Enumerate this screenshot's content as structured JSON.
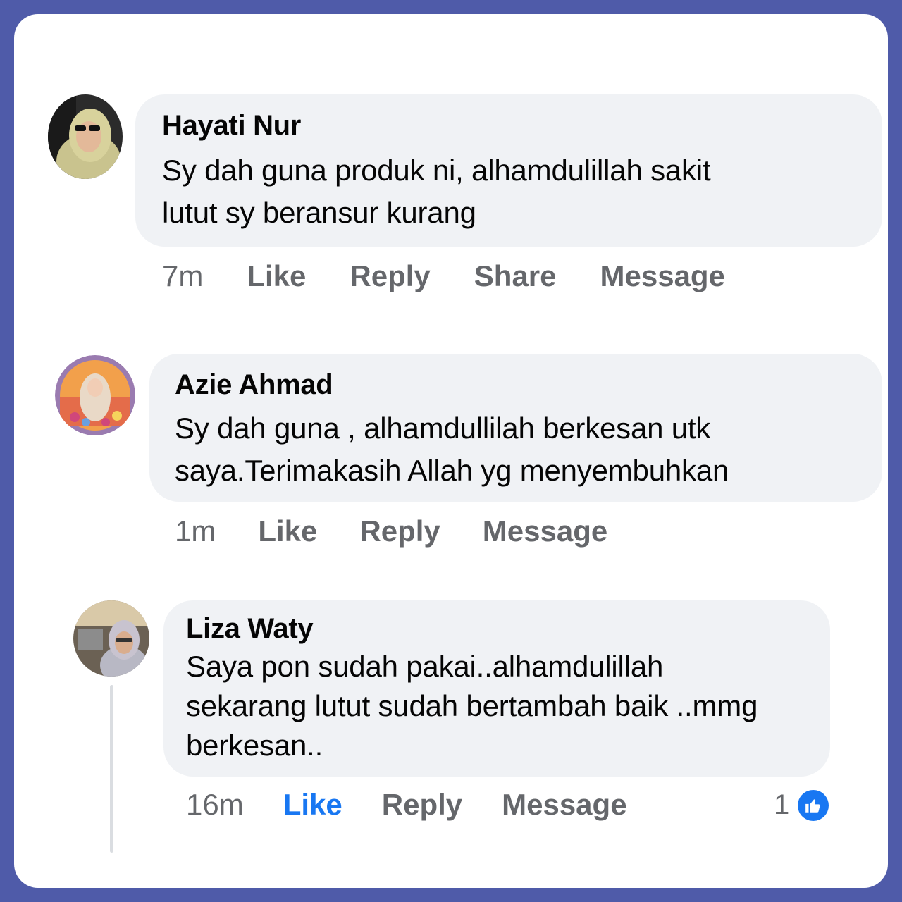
{
  "colors": {
    "frame": "#4f5ba9",
    "bubble": "#f0f2f5",
    "like_active": "#1877f2",
    "muted": "#65676b"
  },
  "comments": [
    {
      "author": "Hayati Nur",
      "text_lines": [
        "Sy dah guna produk ni, alhamdulillah sakit",
        "lutut sy beransur kurang"
      ],
      "time": "7m",
      "actions": [
        "Like",
        "Reply",
        "Share",
        "Message"
      ]
    },
    {
      "author": "Azie Ahmad",
      "text_lines": [
        "Sy dah guna , alhamdullilah berkesan utk",
        "saya.Terimakasih Allah yg menyembuhkan"
      ],
      "time": "1m",
      "actions": [
        "Like",
        "Reply",
        "Message"
      ]
    },
    {
      "author": "Liza Waty",
      "text_lines": [
        "Saya pon sudah pakai..alhamdulillah",
        "sekarang lutut sudah bertambah baik ..mmg",
        "berkesan.."
      ],
      "time": "16m",
      "actions": [
        "Like",
        "Reply",
        "Message"
      ],
      "liked": true,
      "reaction_count": "1",
      "reaction_icon": "thumbs-up-icon"
    }
  ]
}
